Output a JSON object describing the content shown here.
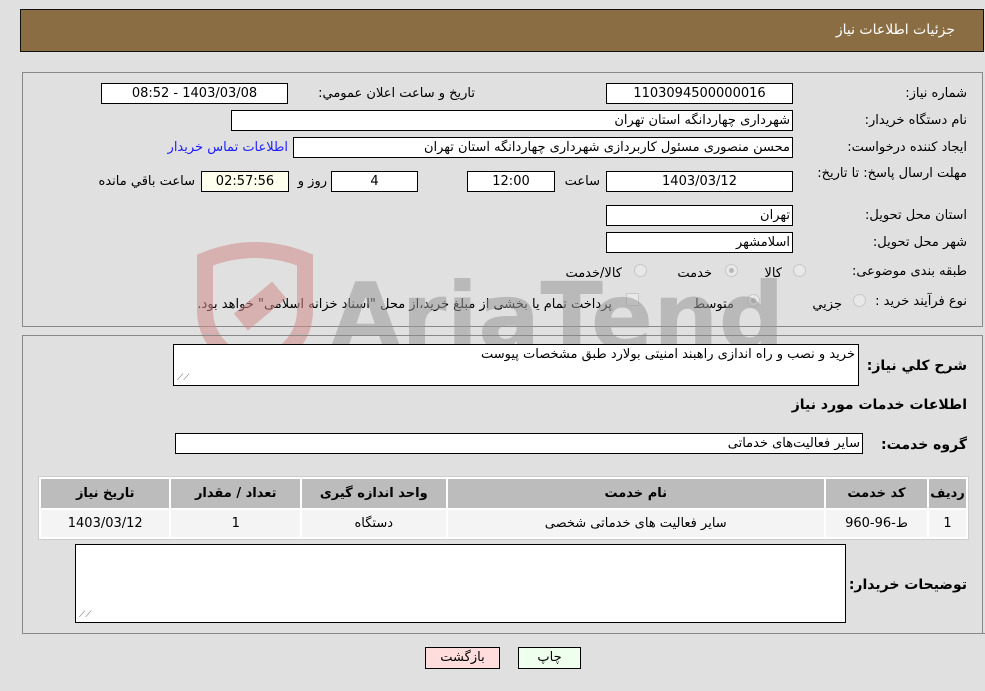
{
  "header": {
    "title": "جزئیات اطلاعات نیاز"
  },
  "details": {
    "need_number_label": "شماره نیاز:",
    "need_number": "1103094500000016",
    "announce_label": "تاریخ و ساعت اعلان عمومي:",
    "announce_value": "1403/03/08 - 08:52",
    "buyer_org_label": "نام دستگاه خريدار:",
    "buyer_org": "شهرداری چهاردانگه استان تهران",
    "creator_label": "ایجاد کننده درخواست:",
    "creator": "محسن منصوری مسئول کاربردازی شهرداری چهاردانگه استان تهران",
    "contact_link": "اطلاعات تماس خريدار",
    "deadline_label": "مهلت ارسال پاسخ: تا تاریخ:",
    "deadline_date": "1403/03/12",
    "hour_label": "ساعت",
    "deadline_time": "12:00",
    "days_value": "4",
    "days_label": "روز و",
    "remaining_time": "02:57:56",
    "remaining_label": "ساعت باقي مانده",
    "province_label": "استان محل تحویل:",
    "province": "تهران",
    "city_label": "شهر محل تحویل:",
    "city": "اسلامشهر",
    "category_label": "طبقه بندی موضوعی:",
    "category_options": [
      {
        "label": "کالا",
        "checked": false
      },
      {
        "label": "خدمت",
        "checked": true
      },
      {
        "label": "کالا/خدمت",
        "checked": false
      }
    ],
    "process_label": "نوع فرآیند خرید :",
    "process_options": [
      {
        "label": "جزيي",
        "checked": false
      },
      {
        "label": "متوسط",
        "checked": true
      }
    ],
    "treasury_checkbox_checked": false,
    "treasury_text": "پرداخت تمام یا بخشی از مبلغ خرید،از محل \"اسناد خزانه اسلامی\" خواهد بود."
  },
  "summary": {
    "description_label": "شرح كلي نياز:",
    "description": "خرید و نصب و راه اندازی راهبند امنیتی بولارد طبق مشخصات پیوست",
    "services_heading": "اطلاعات خدمات مورد نیاز",
    "service_group_label": "گروه خدمت:",
    "service_group": "سایر فعالیت‌های خدماتی"
  },
  "table": {
    "headers": [
      "ردیف",
      "کد خدمت",
      "نام خدمت",
      "واحد اندازه گیری",
      "تعداد / مقدار",
      "تاریخ نیاز"
    ],
    "rows": [
      [
        "1",
        "ط-96-960",
        "سایر فعالیت های خدماتی شخصی",
        "دستگاه",
        "1",
        "1403/03/12"
      ]
    ]
  },
  "buyer_notes": {
    "label": "توضیحات خریدار:",
    "value": ""
  },
  "buttons": {
    "print": "چاپ",
    "back": "بازگشت"
  },
  "colors": {
    "header_bg": "#8b6d43",
    "print_bg": "#eeffee",
    "back_bg": "#ffdddd",
    "link": "#2020ff"
  },
  "watermark": {
    "text": "AriaTender.neT"
  }
}
